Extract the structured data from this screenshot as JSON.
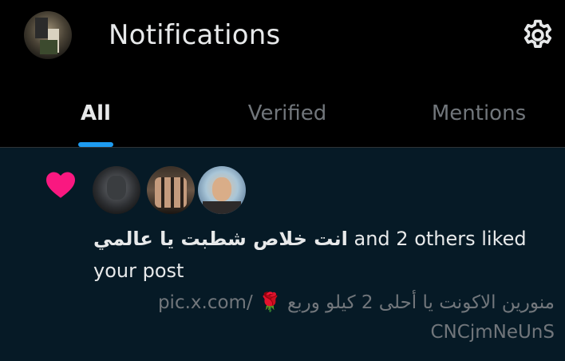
{
  "header": {
    "title": "Notifications",
    "avatar_icon": "profile-avatar",
    "settings_icon": "gear-icon"
  },
  "tabs": [
    {
      "label": "All",
      "active": true
    },
    {
      "label": "Verified",
      "active": false
    },
    {
      "label": "Mentions",
      "active": false
    }
  ],
  "notification": {
    "type_icon": "heart-icon",
    "type_color": "#f91880",
    "actor_name": "انت خلاص شطبت يا عالمي",
    "action_text": "and 2 others liked your post",
    "post_preview_line1": "منورين الاكونت يا أحلى 2 كيلو وربع 🌹 /pic.x.com",
    "post_preview_line2": "CNCjmNeUnS"
  },
  "colors": {
    "background": "#000000",
    "notification_bg": "#061a26",
    "accent": "#1d9bf0",
    "muted_text": "#71767b",
    "primary_text": "#e7e9ea"
  }
}
